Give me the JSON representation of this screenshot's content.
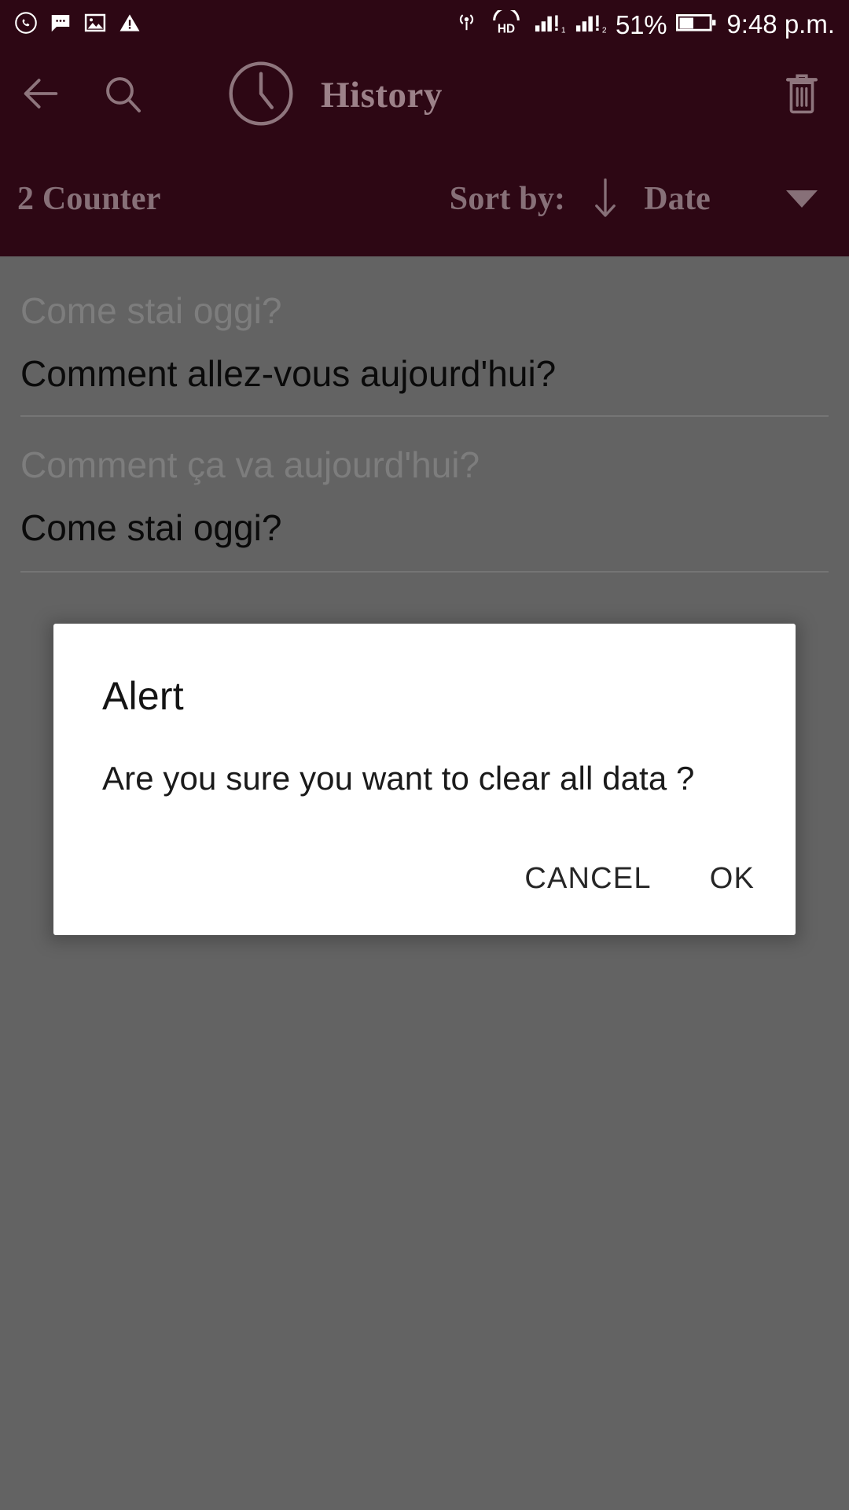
{
  "status_bar": {
    "left_icons": [
      {
        "name": "whatsapp-icon",
        "label": "WhatsApp"
      },
      {
        "name": "message-icon",
        "label": "Messages"
      },
      {
        "name": "image-icon",
        "label": "Screenshot"
      },
      {
        "name": "warning-icon",
        "label": "Warning"
      }
    ],
    "right_icons": [
      {
        "name": "hotspot-icon",
        "label": "Hotspot"
      },
      {
        "name": "hd-voice-icon",
        "label": "HD"
      },
      {
        "name": "signal-sim1-icon",
        "label": "Signal SIM 1"
      },
      {
        "name": "signal-sim2-icon",
        "label": "Signal SIM 2"
      },
      {
        "name": "battery-icon",
        "label": "Battery"
      }
    ],
    "battery_percent": "51%",
    "time": "9:48 p.m."
  },
  "app_bar": {
    "back_icon": "arrow-left-icon",
    "search_icon": "search-icon",
    "clock_icon": "clock-icon",
    "title": "History",
    "delete_icon": "trash-icon"
  },
  "sort_bar": {
    "counter": "2 Counter",
    "sort_by_label": "Sort by:",
    "sort_direction_icon": "arrow-down-icon",
    "sort_field": "Date",
    "caret_icon": "chevron-down-icon"
  },
  "history": {
    "items": [
      {
        "source_text": "Come stai oggi?",
        "target_text": "Comment allez-vous aujourd'hui?"
      },
      {
        "source_text": "Comment ça va aujourd'hui?",
        "target_text": "Come stai oggi?"
      }
    ]
  },
  "dialog": {
    "title": "Alert",
    "message": "Are you sure you want to clear all data ?",
    "cancel_label": "CANCEL",
    "ok_label": "OK"
  },
  "colors": {
    "app_bar_bg": "#2d0714",
    "app_bar_text": "#9c8189",
    "scrim": "#636363",
    "dialog_bg": "#ffffff",
    "status_text": "#ffffff"
  }
}
